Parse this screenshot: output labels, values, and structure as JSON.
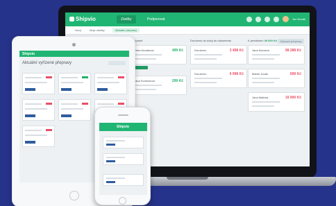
{
  "laptop": {
    "app_name": "Shipvio",
    "tabs": [
      "Zásilky",
      "Podporovat"
    ],
    "user_name": "Jan Novák",
    "subtabs": [
      "Nový",
      "Moje zásilky",
      "Aktuální přepravy"
    ],
    "action_button": "Zobrazit přepravy",
    "columns": [
      {
        "title": "V přípravě",
        "count": "",
        "cards": [
          {
            "name": "Petra Nováková",
            "price": "499 Kč",
            "tone": "green"
          },
          {
            "name": "Jana Svobodová",
            "price": "299 Kč",
            "tone": "green"
          }
        ]
      },
      {
        "title": "Doručeno do doby do dokumentu",
        "count": "",
        "cards": [
          {
            "name": "Doručeno",
            "price": "3 498 Kč",
            "tone": "red"
          },
          {
            "name": "Doručeno",
            "price": "6 998 Kč",
            "tone": "red"
          }
        ]
      },
      {
        "title": "K předložení",
        "count": "49 000 Kč",
        "cards": [
          {
            "name": "Jana Novotná",
            "price": "98 288 Kč",
            "tone": "red"
          },
          {
            "name": "Martin Jonáš",
            "price": "699 Kč",
            "tone": "red"
          },
          {
            "name": "Jana Malická",
            "price": "16 900 Kč",
            "tone": "red"
          }
        ]
      }
    ]
  },
  "tablet": {
    "app_name": "Shipvio",
    "title": "Aktuální vyřízené přepravy"
  },
  "phone": {
    "app_name": "Shipvio"
  }
}
